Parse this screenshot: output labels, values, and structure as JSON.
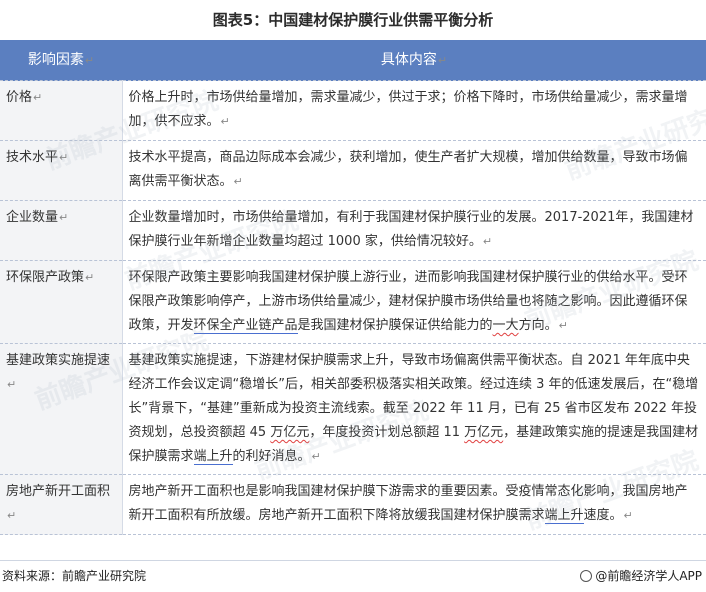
{
  "title": "图表5：中国建材保护膜行业供需平衡分析",
  "table": {
    "headers": [
      "影响因素",
      "具体内容"
    ],
    "return_mark": "↵",
    "rows": [
      {
        "factor": "价格",
        "content": "价格上升时，市场供给量增加，需求量减少，供过于求；价格下降时，市场供给量减少，需求量增加，供不应求。"
      },
      {
        "factor": "技术水平",
        "content": "技术水平提高，商品边际成本会减少，获利增加，使生产者扩大规模，增加供给数量，导致市场偏离供需平衡状态。"
      },
      {
        "factor": "企业数量",
        "content": "企业数量增加时，市场供给量增加，有利于我国建材保护膜行业的发展。2017-2021年，我国建材保护膜行业年新增企业数量均超过 1000 家，供给情况较好。"
      },
      {
        "factor": "环保限产政策",
        "content_parts": [
          "环保限产政策主要影响我国建材保护膜上游行业，进而影响我国建材保护膜行业的供给水平。受环保限产政策影响停产，上游市场供给量减少，建材保护膜市场供给量也将随之影响。因此遵循环保政策，开发",
          "环保全产业链产品",
          "是我国建材保护膜保证供给能力的",
          "一大",
          "方向。"
        ]
      },
      {
        "factor": "基建政策实施提速",
        "content_parts": [
          "基建政策实施提速，下游建材保护膜需求上升，导致市场偏离供需平衡状态。自 2021 年年底中央经济工作会议定调“稳增长”后，相关部委积极落实相关政策。经过连续 3 年的低速发展后，在“稳增长”背景下，“基建”重新成为投资主流线索。截至 2022 年 11 月，已有 25 省市区发布 2022 年投资规划，总投资额超 45 ",
          "万亿元",
          "，年度投资计划总额超 11 ",
          "万亿元",
          "，基建政策实施的提速是我国建材保护膜需求",
          "端上升",
          "的利好消息。"
        ]
      },
      {
        "factor": "房地产新开工面积",
        "content_parts": [
          "房地产新开工面积也是影响我国建材保护膜下游需求的重要因素。受疫情常态化影响，我国房地产新开工面积有所放缓。房地产新开工面积下降将放缓我国建材保护膜需求",
          "端上升",
          "速度。"
        ]
      }
    ]
  },
  "footer": {
    "source": "资料来源：前瞻产业研究院",
    "brand": "@前瞻经济学人APP"
  },
  "watermark": "前瞻产业研究院"
}
